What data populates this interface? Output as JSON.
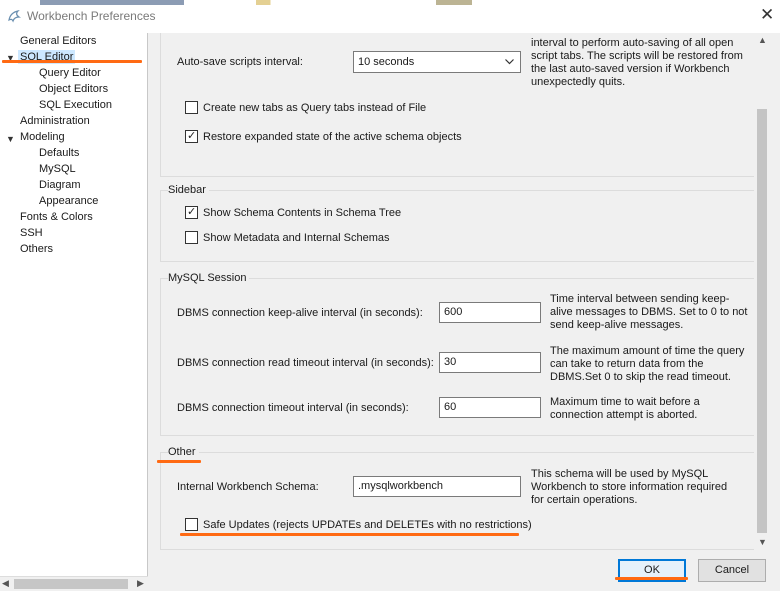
{
  "window": {
    "title": "Workbench Preferences",
    "close_glyph": "✕",
    "icon": "mysql-dolphin-icon"
  },
  "sidebar": {
    "items": [
      {
        "label": "General Editors"
      },
      {
        "label": "SQL Editor"
      },
      {
        "label": "Query Editor"
      },
      {
        "label": "Object Editors"
      },
      {
        "label": "SQL Execution"
      },
      {
        "label": "Administration"
      },
      {
        "label": "Modeling"
      },
      {
        "label": "Defaults"
      },
      {
        "label": "MySQL"
      },
      {
        "label": "Diagram"
      },
      {
        "label": "Appearance"
      },
      {
        "label": "Fonts & Colors"
      },
      {
        "label": "SSH"
      },
      {
        "label": "Others"
      }
    ],
    "selected": "SQL Editor",
    "expand_glyph": "▼",
    "scroll_left": "◀",
    "scroll_right": "▶"
  },
  "general": {
    "autosave_label": "Auto-save scripts interval:",
    "autosave_value": "10 seconds",
    "autosave_desc": "interval to perform auto-saving of all open script tabs. The scripts will be restored from the last auto-saved version if Workbench unexpectedly quits.",
    "new_tabs_label": "Create new tabs as Query tabs instead of File",
    "new_tabs_checked": false,
    "restore_label": "Restore expanded state of the active schema objects",
    "restore_checked": true
  },
  "sidebar_group": {
    "title": "Sidebar",
    "show_contents_label": "Show Schema Contents in Schema Tree",
    "show_contents_checked": true,
    "show_metadata_label": "Show Metadata and Internal Schemas",
    "show_metadata_checked": false
  },
  "session": {
    "title": "MySQL Session",
    "keepalive_label": "DBMS connection keep-alive interval (in seconds):",
    "keepalive_value": "600",
    "keepalive_desc": "Time interval between sending keep-alive messages to DBMS. Set to 0 to not send keep-alive messages.",
    "read_timeout_label": "DBMS connection read timeout interval (in seconds):",
    "read_timeout_value": "30",
    "read_timeout_desc": "The maximum amount of time the query can take to return data from the DBMS.Set 0 to skip the read timeout.",
    "conn_timeout_label": "DBMS connection timeout interval (in seconds):",
    "conn_timeout_value": "60",
    "conn_timeout_desc": "Maximum time to wait before a connection attempt is aborted."
  },
  "other": {
    "title": "Other",
    "schema_label": "Internal Workbench Schema:",
    "schema_value": ".mysqlworkbench",
    "schema_desc": "This schema will be used by MySQL Workbench to store information required for certain operations.",
    "safe_updates_label": "Safe Updates (rejects UPDATEs and DELETEs with no restrictions)",
    "safe_updates_checked": false
  },
  "buttons": {
    "ok": "OK",
    "cancel": "Cancel"
  },
  "scrollbar": {
    "up": "▲",
    "down": "▼"
  },
  "colors": {
    "annotation": "#ff6a13",
    "selection": "#cde8ff",
    "default_button_border": "#0078d7"
  }
}
